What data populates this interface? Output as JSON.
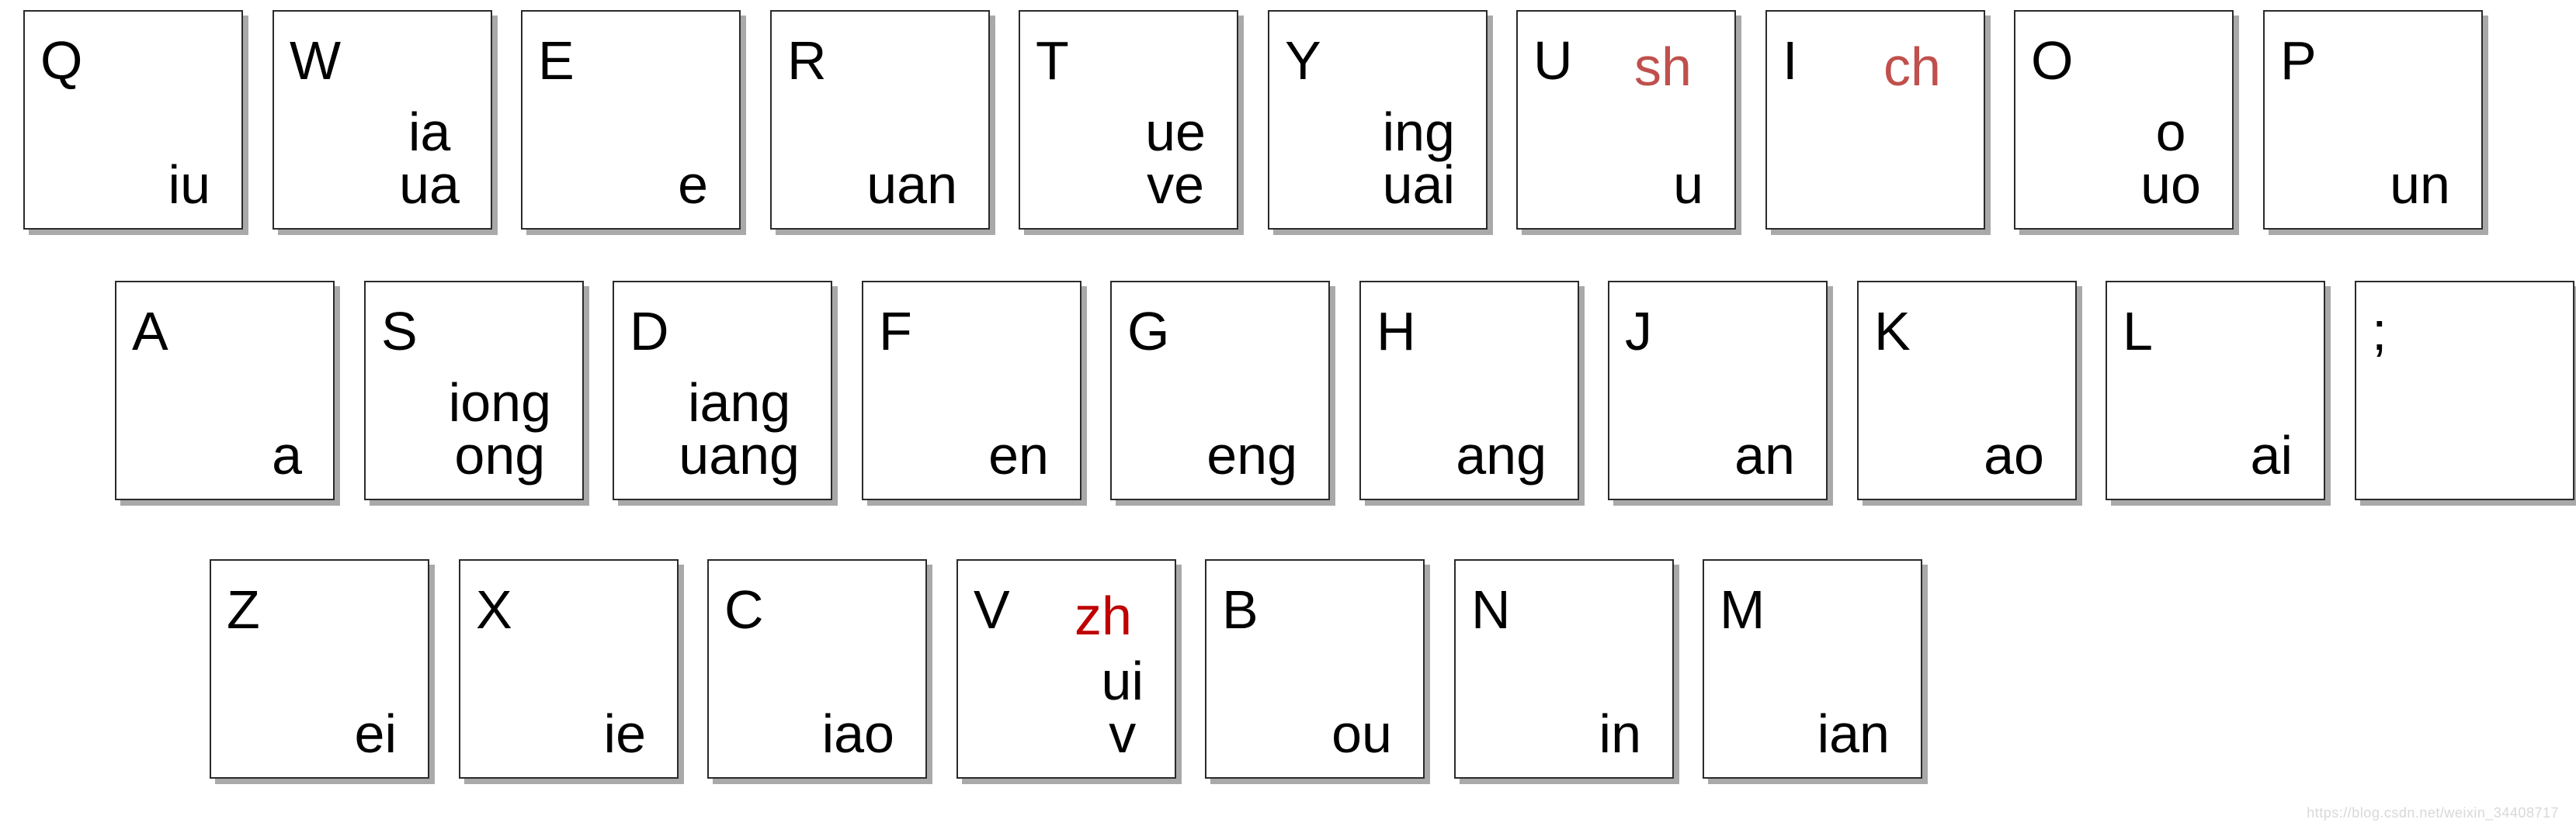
{
  "keyboard": {
    "rows": [
      {
        "keys": [
          {
            "letter": "Q",
            "initial": "",
            "finals": [
              "iu"
            ]
          },
          {
            "letter": "W",
            "initial": "",
            "finals": [
              "ia",
              "ua"
            ]
          },
          {
            "letter": "E",
            "initial": "",
            "finals": [
              "e"
            ]
          },
          {
            "letter": "R",
            "initial": "",
            "finals": [
              "uan"
            ]
          },
          {
            "letter": "T",
            "initial": "",
            "finals": [
              "ue",
              "ve"
            ]
          },
          {
            "letter": "Y",
            "initial": "",
            "finals": [
              "ing",
              "uai"
            ]
          },
          {
            "letter": "U",
            "initial": "sh",
            "initial_color": "#c0504d",
            "finals": [
              "u"
            ]
          },
          {
            "letter": "I",
            "initial": "ch",
            "initial_color": "#c0504d",
            "finals": []
          },
          {
            "letter": "O",
            "initial": "",
            "finals": [
              "o",
              "uo"
            ]
          },
          {
            "letter": "P",
            "initial": "",
            "finals": [
              "un"
            ]
          }
        ]
      },
      {
        "keys": [
          {
            "letter": "A",
            "initial": "",
            "finals": [
              "a"
            ]
          },
          {
            "letter": "S",
            "initial": "",
            "finals": [
              "iong",
              "ong"
            ]
          },
          {
            "letter": "D",
            "initial": "",
            "finals": [
              "iang",
              "uang"
            ]
          },
          {
            "letter": "F",
            "initial": "",
            "finals": [
              "en"
            ]
          },
          {
            "letter": "G",
            "initial": "",
            "finals": [
              "eng"
            ]
          },
          {
            "letter": "H",
            "initial": "",
            "finals": [
              "ang"
            ]
          },
          {
            "letter": "J",
            "initial": "",
            "finals": [
              "an"
            ]
          },
          {
            "letter": "K",
            "initial": "",
            "finals": [
              "ao"
            ]
          },
          {
            "letter": "L",
            "initial": "",
            "finals": [
              "ai"
            ]
          },
          {
            "letter": ";",
            "initial": "",
            "finals": []
          }
        ]
      },
      {
        "keys": [
          {
            "letter": "Z",
            "initial": "",
            "finals": [
              "ei"
            ]
          },
          {
            "letter": "X",
            "initial": "",
            "finals": [
              "ie"
            ]
          },
          {
            "letter": "C",
            "initial": "",
            "finals": [
              "iao"
            ]
          },
          {
            "letter": "V",
            "initial": "zh",
            "initial_color": "#c00000",
            "finals": [
              "ui",
              "v"
            ]
          },
          {
            "letter": "B",
            "initial": "",
            "finals": [
              "ou"
            ]
          },
          {
            "letter": "N",
            "initial": "",
            "finals": [
              "in"
            ]
          },
          {
            "letter": "M",
            "initial": "",
            "finals": [
              "ian"
            ]
          }
        ]
      }
    ]
  },
  "watermark": "https://blog.csdn.net/weixin_34408717"
}
